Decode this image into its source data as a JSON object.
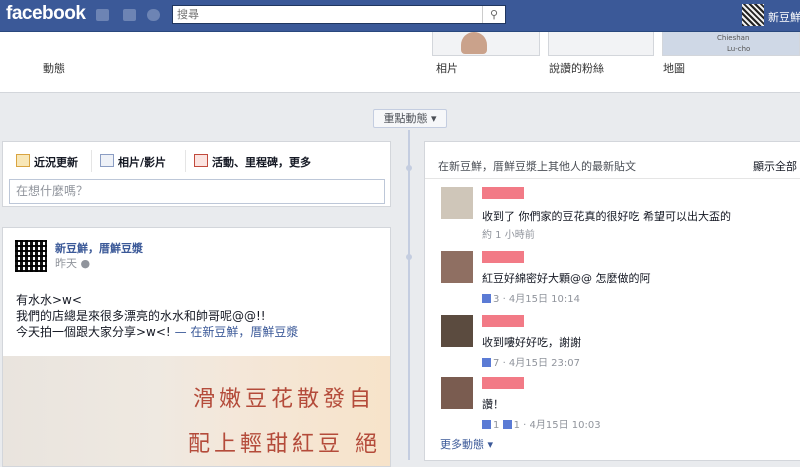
{
  "header": {
    "logo": "facebook",
    "search_placeholder": "搜尋",
    "username": "新豆鮮"
  },
  "cover": {
    "label_left": "動態",
    "thumbs": [
      {
        "label": "相片"
      },
      {
        "label": "說讚的粉絲"
      },
      {
        "label": "地圖",
        "map_text_1": "Chieshan",
        "map_text_2": "Lu-cho"
      }
    ]
  },
  "divider": {
    "label": "重點動態 ▾"
  },
  "composer": {
    "tabs": [
      {
        "label": "近況更新"
      },
      {
        "label": "相片/影片"
      },
      {
        "label": "活動、里程碑，更多"
      }
    ],
    "placeholder": "在想什麼嗎？"
  },
  "post": {
    "author": "新豆鮮，厝鮮豆漿",
    "time": "昨天",
    "lines": [
      "有水水>w<",
      "我們的店總是來很多漂亮的水水和帥哥呢@@!!",
      "今天拍一個跟大家分享>w<!"
    ],
    "place_prefix": "— 在",
    "place": "新豆鮮，厝鮮豆漿",
    "image_text_1": "滑嫩豆花散發自",
    "image_text_2": "配上輕甜紅豆 絕"
  },
  "recent": {
    "heading": "在新豆鮮，厝鮮豆漿上其他人的最新貼文",
    "see_all": "顯示全部",
    "items": [
      {
        "text": "收到了 你們家的豆花真的很好吃 希望可以出大盃的",
        "meta": "約 1 小時前",
        "likes": "",
        "comments": ""
      },
      {
        "text": "紅豆好綿密好大顆@@ 怎麼做的阿",
        "meta": "· 4月15日 10:14",
        "likes": "3",
        "comments": ""
      },
      {
        "text": "收到嘍好好吃，謝謝",
        "meta": "· 4月15日 23:07",
        "likes": "",
        "comments": "7"
      },
      {
        "text": "讚！",
        "meta": "· 4月15日 10:03",
        "likes": "1",
        "comments": "1"
      }
    ],
    "more": "更多動態 ▾"
  }
}
